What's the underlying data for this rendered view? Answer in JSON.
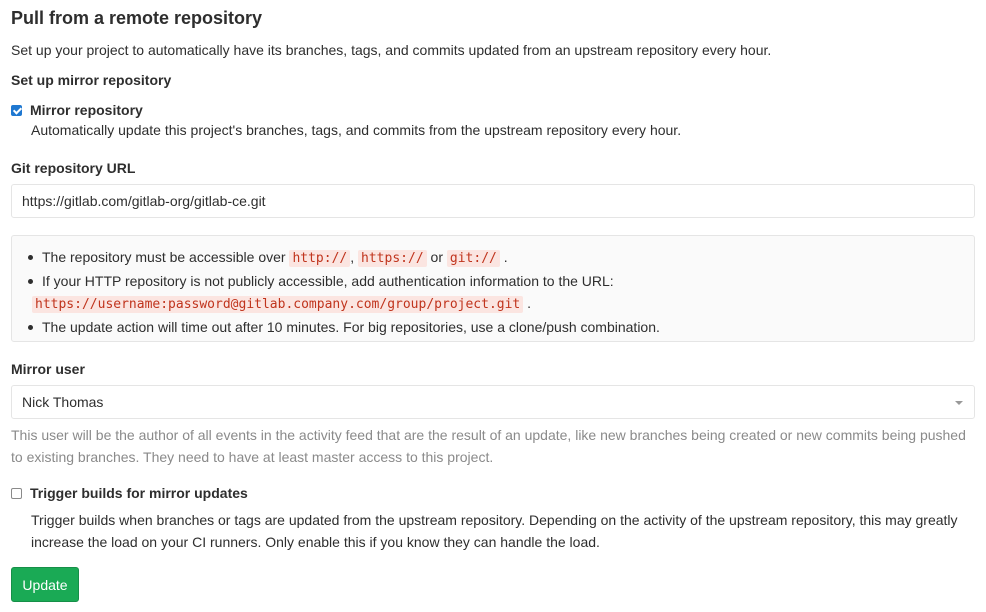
{
  "section": {
    "title": "Pull from a remote repository",
    "lead": "Set up your project to automatically have its branches, tags, and commits updated from an upstream repository every hour."
  },
  "mirror_setup": {
    "heading": "Set up mirror repository",
    "mirror_checkbox": {
      "label": "Mirror repository",
      "checked": true,
      "help": "Automatically update this project's branches, tags, and commits from the upstream repository every hour."
    }
  },
  "git_url": {
    "label": "Git repository URL",
    "value": "https://gitlab.com/gitlab-org/gitlab-ce.git"
  },
  "info": {
    "item1_text": "The repository must be accessible over",
    "protocol_http": "http://",
    "sep1": ",",
    "protocol_https": "https://",
    "sep2": "or",
    "protocol_git": "git://",
    "end1": ".",
    "item2_text": "If your HTTP repository is not publicly accessible, add authentication information to the URL:",
    "auth_url": "https://username:password@gitlab.company.com/group/project.git",
    "end2": ".",
    "item3_text": "The update action will time out after 10 minutes. For big repositories, use a clone/push combination."
  },
  "mirror_user": {
    "label": "Mirror user",
    "selected": "Nick Thomas",
    "help": "This user will be the author of all events in the activity feed that are the result of an update, like new branches being created or new commits being pushed to existing branches. They need to have at least master access to this project."
  },
  "trigger_builds": {
    "label": "Trigger builds for mirror updates",
    "checked": false,
    "help": "Trigger builds when branches or tags are updated from the upstream repository. Depending on the activity of the upstream repository, this may greatly increase the load on your CI runners. Only enable this if you know they can handle the load."
  },
  "actions": {
    "update_label": "Update"
  },
  "colors": {
    "primary": "#1f78d1",
    "success": "#1aaa55",
    "code_text": "#c0341d",
    "code_bg": "#fbe5e1",
    "muted": "#8a8a8a"
  }
}
